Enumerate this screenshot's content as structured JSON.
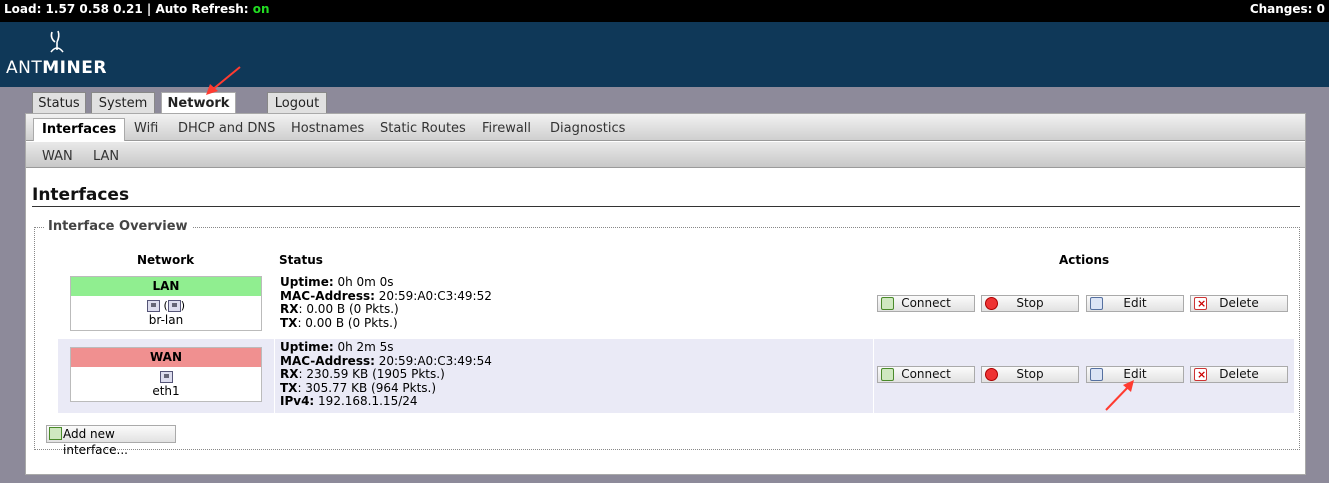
{
  "topbar": {
    "load_label": "Load: 1.57 0.58 0.21 | Auto Refresh: ",
    "auto_refresh_value": "on",
    "changes": "Changes: 0"
  },
  "logo": {
    "ant": "ANT",
    "miner": "MINER"
  },
  "main_tabs": [
    "Status",
    "System",
    "Network",
    "Logout"
  ],
  "sub_tabs": [
    "Interfaces",
    "Wifi",
    "DHCP and DNS",
    "Hostnames",
    "Static Routes",
    "Firewall",
    "Diagnostics"
  ],
  "subsub_tabs": [
    "WAN",
    "LAN"
  ],
  "page_title": "Interfaces",
  "section_title": "Interface Overview",
  "columns": {
    "network": "Network",
    "status": "Status",
    "actions": "Actions"
  },
  "interfaces": [
    {
      "name": "LAN",
      "device": "br-lan",
      "status": {
        "uptime_label": "Uptime:",
        "uptime": " 0h 0m 0s",
        "mac_label": "MAC-Address:",
        "mac": " 20:59:A0:C3:49:52",
        "rx_label": "RX",
        "rx": ": 0.00 B (0 Pkts.)",
        "tx_label": "TX",
        "tx": ": 0.00 B (0 Pkts.)"
      }
    },
    {
      "name": "WAN",
      "device": "eth1",
      "status": {
        "uptime_label": "Uptime:",
        "uptime": " 0h 2m 5s",
        "mac_label": "MAC-Address:",
        "mac": " 20:59:A0:C3:49:54",
        "rx_label": "RX",
        "rx": ": 230.59 KB (1905 Pkts.)",
        "tx_label": "TX",
        "tx": ": 305.77 KB (964 Pkts.)",
        "ipv4_label": "IPv4:",
        "ipv4": " 192.168.1.15/24"
      }
    }
  ],
  "actions": {
    "connect": "Connect",
    "stop": "Stop",
    "edit": "Edit",
    "delete": "Delete"
  },
  "add_interface": "Add new interface...",
  "colors": {
    "header_bg": "#0f3858",
    "lan_green": "#90ee90",
    "wan_red": "#f09090",
    "annotation_arrow": "#ff3b30"
  }
}
